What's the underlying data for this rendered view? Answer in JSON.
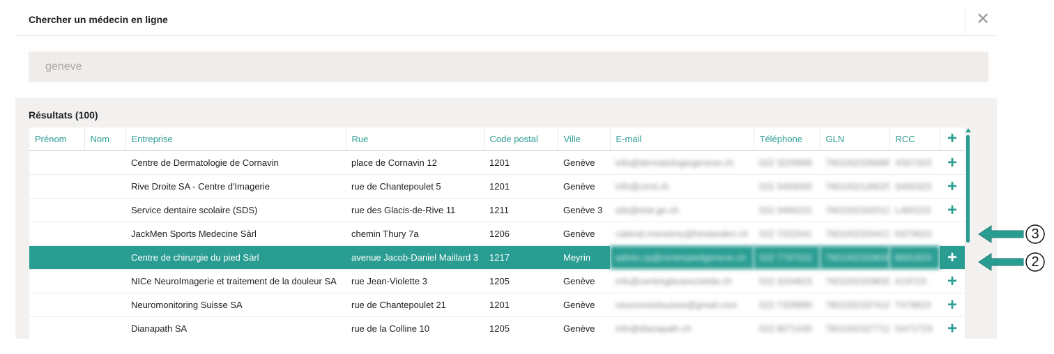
{
  "dialog": {
    "title": "Chercher un médecin en ligne",
    "close_icon": "close-icon",
    "close_glyph": "✕"
  },
  "search": {
    "value": "geneve"
  },
  "results": {
    "title": "Résultats (100)",
    "columns": [
      "Prénom",
      "Nom",
      "Entreprise",
      "Rue",
      "Code postal",
      "Ville",
      "E-mail",
      "Téléphone",
      "GLN",
      "RCC",
      "+"
    ],
    "rows": [
      {
        "prenom": "",
        "nom": "",
        "entreprise": "Centre de Dermatologie de Cornavin",
        "rue": "place de Cornavin 12",
        "cp": "1201",
        "ville": "Genève",
        "email": "info@dermatologiegeneve.ch",
        "tel": "022 3229999",
        "gln": "7601002336688",
        "rcc": "X507323",
        "add": "+"
      },
      {
        "prenom": "",
        "nom": "",
        "entreprise": "Rive Droite SA - Centre d'Imagerie",
        "rue": "rue de Chantepoulet 5",
        "cp": "1201",
        "ville": "Genève",
        "email": "info@cirrd.ch",
        "tel": "022 3459000",
        "gln": "7601002128025",
        "rcc": "S465323",
        "add": "+"
      },
      {
        "prenom": "",
        "nom": "",
        "entreprise": "Service dentaire scolaire (SDS)",
        "rue": "rue des Glacis-de-Rive 11",
        "cp": "1211",
        "ville": "Genève 3",
        "email": "sds@etat.ge.ch",
        "tel": "022 3466101",
        "gln": "7601002332013",
        "rcc": "L465223",
        "add": "+"
      },
      {
        "prenom": "",
        "nom": "",
        "entreprise": "JackMen Sports Medecine Sàrl",
        "rue": "chemin Thury 7a",
        "cp": "1206",
        "ville": "Genève",
        "email": "cabinet.menetrey@hirslanden.ch",
        "tel": "022 7022541",
        "gln": "7601002334413",
        "rcc": "K679623",
        "add": ""
      },
      {
        "prenom": "",
        "nom": "",
        "entreprise": "Centre de chirurgie du pied Sàrl",
        "rue": "avenue Jacob-Daniel Maillard 3",
        "cp": "1217",
        "ville": "Meyrin",
        "email": "admin.cp@centrepiedgeneve.ch",
        "tel": "022 7797022",
        "gln": "7601002329839",
        "rcc": "B691823",
        "add": "+"
      },
      {
        "prenom": "",
        "nom": "",
        "entreprise": "NICe NeuroImagerie et traitement de la douleur SA",
        "rue": "rue Jean-Violette 3",
        "cp": "1205",
        "ville": "Genève",
        "email": "info@centreglavanciolette.ch",
        "tel": "022 3204823",
        "gln": "7601002329839",
        "rcc": "A19723",
        "add": "+"
      },
      {
        "prenom": "",
        "nom": "",
        "entreprise": "Neuromonitoring Suisse SA",
        "rue": "rue de Chantepoulet 21",
        "cp": "1201",
        "ville": "Genève",
        "email": "neuromonitsuisse@gmail.com",
        "tel": "022 7328880",
        "gln": "7601002337416",
        "rcc": "T479823",
        "add": "+"
      },
      {
        "prenom": "",
        "nom": "",
        "entreprise": "Dianapath SA",
        "rue": "rue de la Colline 10",
        "cp": "1205",
        "ville": "Genève",
        "email": "info@dianapath.ch",
        "tel": "022 8071430",
        "gln": "7601002327712",
        "rcc": "G471723",
        "add": "+"
      }
    ]
  },
  "callouts": [
    {
      "number": "3",
      "icon": "arrow-left-icon"
    },
    {
      "number": "2",
      "icon": "arrow-left-icon"
    }
  ],
  "colors": {
    "accent": "#2a9d92",
    "search_bg": "#efecea",
    "panel_bg": "#f3f1ef"
  }
}
